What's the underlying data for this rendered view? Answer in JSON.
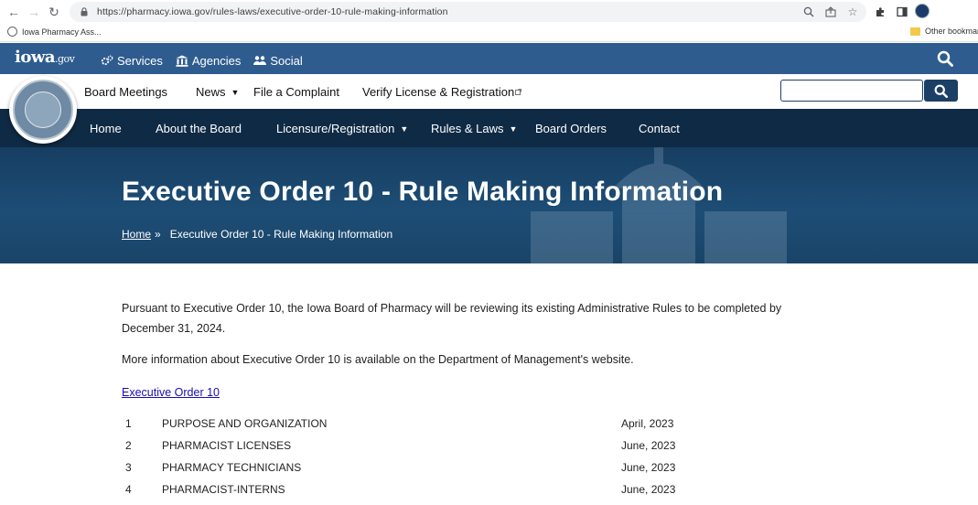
{
  "browser": {
    "url": "https://pharmacy.iowa.gov/rules-laws/executive-order-10-rule-making-information",
    "bookmarks": [
      {
        "label": "Iowa Pharmacy Ass..."
      }
    ],
    "other_bookmarks": "Other bookmarks"
  },
  "gov_bar": {
    "logo": "iowa",
    "logo_suffix": ".gov",
    "links": [
      "Services",
      "Agencies",
      "Social"
    ]
  },
  "header": {
    "top_nav": [
      "Board Meetings",
      "News",
      "File a Complaint",
      "Verify License & Registration"
    ],
    "search_placeholder": ""
  },
  "main_nav": [
    "Home",
    "About the Board",
    "Licensure/Registration",
    "Rules & Laws",
    "Board Orders",
    "Contact"
  ],
  "hero": {
    "title": "Executive Order 10 - Rule Making Information",
    "breadcrumb_home": "Home",
    "breadcrumb_sep": "»",
    "breadcrumb_current": "Executive Order 10 - Rule Making Information"
  },
  "content": {
    "para1": "Pursuant to Executive Order 10, the Iowa Board of Pharmacy will be reviewing its existing Administrative Rules to be completed by December 31, 2024.",
    "para2": "More information about Executive Order 10 is available on the Department of Management's website.",
    "link": "Executive Order 10"
  },
  "rules_table": [
    {
      "num": "1",
      "title": "PURPOSE AND ORGANIZATION",
      "date": "April, 2023"
    },
    {
      "num": "2",
      "title": "PHARMACIST LICENSES",
      "date": "June, 2023"
    },
    {
      "num": "3",
      "title": "PHARMACY TECHNICIANS",
      "date": "June, 2023"
    },
    {
      "num": "4",
      "title": "PHARMACIST-INTERNS",
      "date": "June, 2023"
    }
  ],
  "colors": {
    "gov_bar": "#2f5c8f",
    "main_nav": "#0f2a45",
    "hero": "#1d4d75",
    "link": "#1a0dab"
  }
}
